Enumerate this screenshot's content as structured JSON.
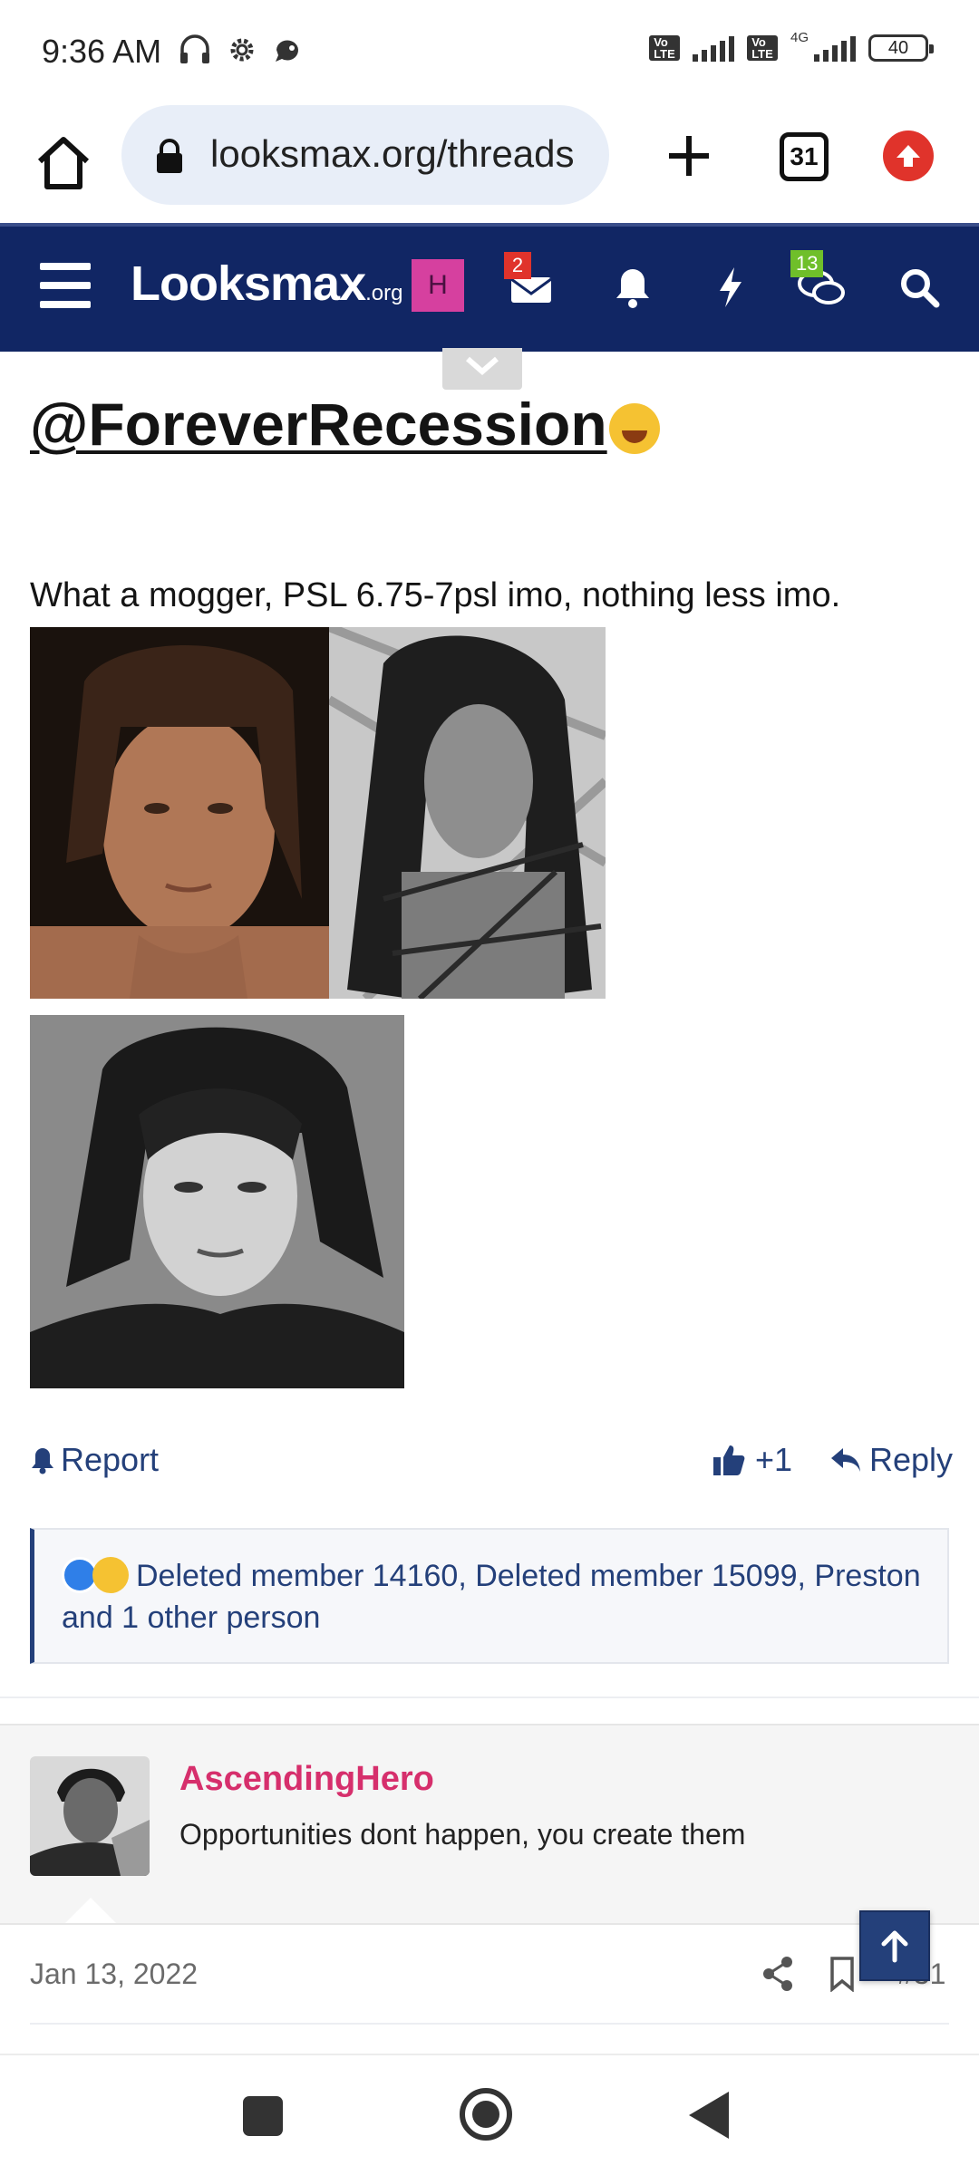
{
  "status_bar": {
    "time": "9:36 AM",
    "battery": "40",
    "network": "4G",
    "volte": "Vo LTE"
  },
  "browser": {
    "url": "looksmax.org/threads",
    "tab_count": "31"
  },
  "site_header": {
    "logo_main": "Looksmax",
    "logo_suffix": ".org",
    "avatar_letter": "H",
    "inbox_badge": "2",
    "conversations_badge": "13"
  },
  "post": {
    "mention": "@ForeverRecession",
    "text": "What a mogger, PSL 6.75-7psl imo, nothing less imo.",
    "report_label": "Report",
    "like_label": "+1",
    "reply_label": "Reply",
    "reactions_text": "Deleted member 14160, Deleted member 15099, Preston and 1 other person"
  },
  "next_post": {
    "username": "AscendingHero",
    "user_title": "Opportunities dont happen, you create them",
    "date": "Jan 13, 2022",
    "post_number": "#31"
  },
  "colors": {
    "header_bg": "#112664",
    "link": "#24407a",
    "username": "#d62f6c",
    "avatar_h": "#d6409f",
    "badge_red": "#e0332b",
    "badge_green": "#6fbf2a"
  }
}
